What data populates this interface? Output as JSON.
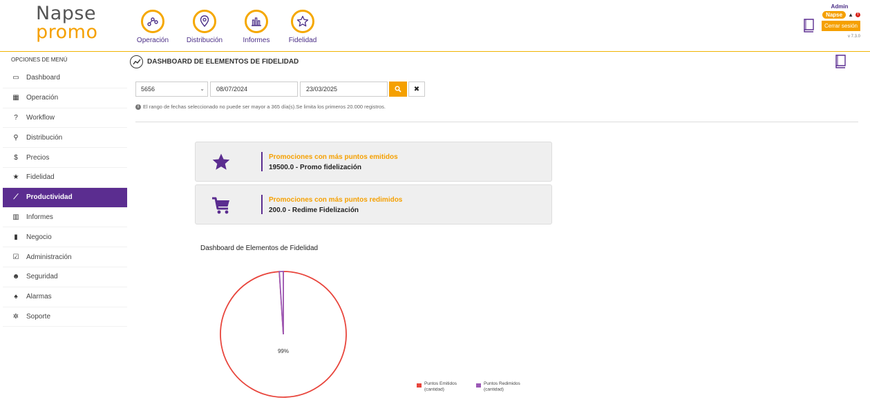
{
  "logo": {
    "line1": "Napse",
    "line2": "promo"
  },
  "topnav": [
    {
      "label": "Operación",
      "icon": "operacion-icon"
    },
    {
      "label": "Distribución",
      "icon": "map-pin-icon"
    },
    {
      "label": "Informes",
      "icon": "bar-chart-icon"
    },
    {
      "label": "Fidelidad",
      "icon": "star-icon"
    }
  ],
  "user": {
    "name": "Admin",
    "badge": "Napse",
    "alert_count": "!",
    "logout_label": "Cerrar sesión",
    "version": "v 7.3.0"
  },
  "sidebar": {
    "title": "OPCIONES DE MENÚ",
    "items": [
      {
        "label": "Dashboard",
        "icon": "laptop-icon",
        "glyph": "▭"
      },
      {
        "label": "Operación",
        "icon": "grid-icon",
        "glyph": "▦"
      },
      {
        "label": "Workflow",
        "icon": "question-circle-icon",
        "glyph": "?"
      },
      {
        "label": "Distribución",
        "icon": "map-marker-icon",
        "glyph": "⚲"
      },
      {
        "label": "Precios",
        "icon": "dollar-icon",
        "glyph": "$"
      },
      {
        "label": "Fidelidad",
        "icon": "star-icon",
        "glyph": "★"
      },
      {
        "label": "Productividad",
        "icon": "line-chart-icon",
        "glyph": "⟋"
      },
      {
        "label": "Informes",
        "icon": "bar-chart-icon",
        "glyph": "▥"
      },
      {
        "label": "Negocio",
        "icon": "building-icon",
        "glyph": "▮"
      },
      {
        "label": "Administración",
        "icon": "calendar-check-icon",
        "glyph": "☑"
      },
      {
        "label": "Seguridad",
        "icon": "users-icon",
        "glyph": "☻"
      },
      {
        "label": "Alarmas",
        "icon": "bell-icon",
        "glyph": "♠"
      },
      {
        "label": "Soporte",
        "icon": "cog-icon",
        "glyph": "✲"
      }
    ],
    "active_index": 6
  },
  "page": {
    "title": "DASHBOARD DE ELEMENTOS DE FIDELIDAD"
  },
  "filters": {
    "select_value": "5656",
    "date_from": "08/07/2024",
    "date_to": "23/03/2025",
    "note": "El rango de fechas seleccionado no puede ser mayor a 365 día(s).Se limita los primeros 20.000 registros."
  },
  "cards": [
    {
      "heading": "Promociones con más puntos emitidos",
      "value": "19500.0 - Promo fidelización",
      "icon": "star-icon"
    },
    {
      "heading": "Promociones con más puntos redimidos",
      "value": "200.0 - Redime Fidelización",
      "icon": "cart-icon"
    }
  ],
  "colors": {
    "accent": "#f5a000",
    "purple": "#5b2d90",
    "series1": "#e8453c",
    "series2": "#9b59b6"
  },
  "chart_data": {
    "type": "pie",
    "title": "Dashboard de Elementos de Fidelidad",
    "slice_label": "99%",
    "legend_position": "bottom-right",
    "series": [
      {
        "name": "Puntos Emitidos (cantidad)",
        "value": 19500,
        "color": "#e8453c"
      },
      {
        "name": "Puntos Redimidos (cantidad)",
        "value": 200,
        "color": "#9b59b6"
      }
    ]
  }
}
